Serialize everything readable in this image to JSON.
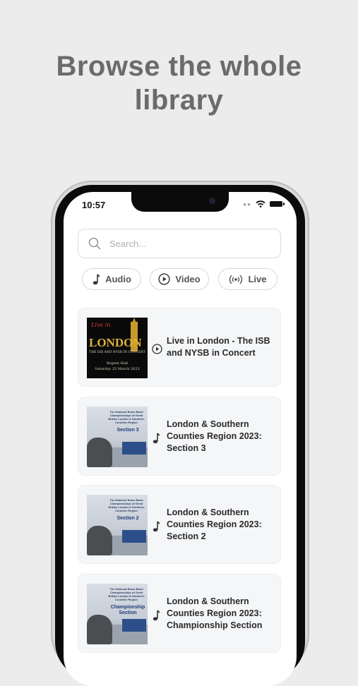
{
  "headline": {
    "line1": "Browse the whole",
    "line2": "library"
  },
  "status_bar": {
    "time": "10:57"
  },
  "search": {
    "placeholder": "Search..."
  },
  "filters": [
    {
      "label": "Audio",
      "icon": "music-note-icon"
    },
    {
      "label": "Video",
      "icon": "play-circle-icon"
    },
    {
      "label": "Live",
      "icon": "broadcast-icon"
    }
  ],
  "items": [
    {
      "title": "Live in London - The ISB and NYSB in Concert",
      "type_icon": "play-circle-icon",
      "thumb": {
        "script": "Live in",
        "big": "LONDON",
        "sub1": "THE ISB AND NYSB IN CONCERT",
        "sub2": "Regent Hall",
        "sub3": "Saturday 25 March 2023"
      }
    },
    {
      "title": "London & Southern Counties Region 2023: Section 3",
      "type_icon": "music-note-icon",
      "thumb": {
        "header": "The National Brass Band Championships of Great Britain London & Southern Counties Region",
        "section": "Section 3"
      }
    },
    {
      "title": "London & Southern Counties Region 2023: Section 2",
      "type_icon": "music-note-icon",
      "thumb": {
        "header": "The National Brass Band Championships of Great Britain London & Southern Counties Region",
        "section": "Section 2"
      }
    },
    {
      "title": "London & Southern Counties Region 2023: Championship Section",
      "type_icon": "music-note-icon",
      "thumb": {
        "header": "The National Brass Band Championships of Great Britain London & Southern Counties Region",
        "section": "Championship Section"
      }
    }
  ],
  "colors": {
    "background": "#ececec",
    "headline": "#6b6b6b",
    "card_bg": "#f5f6f8",
    "chip_border": "#d7d7d7"
  }
}
